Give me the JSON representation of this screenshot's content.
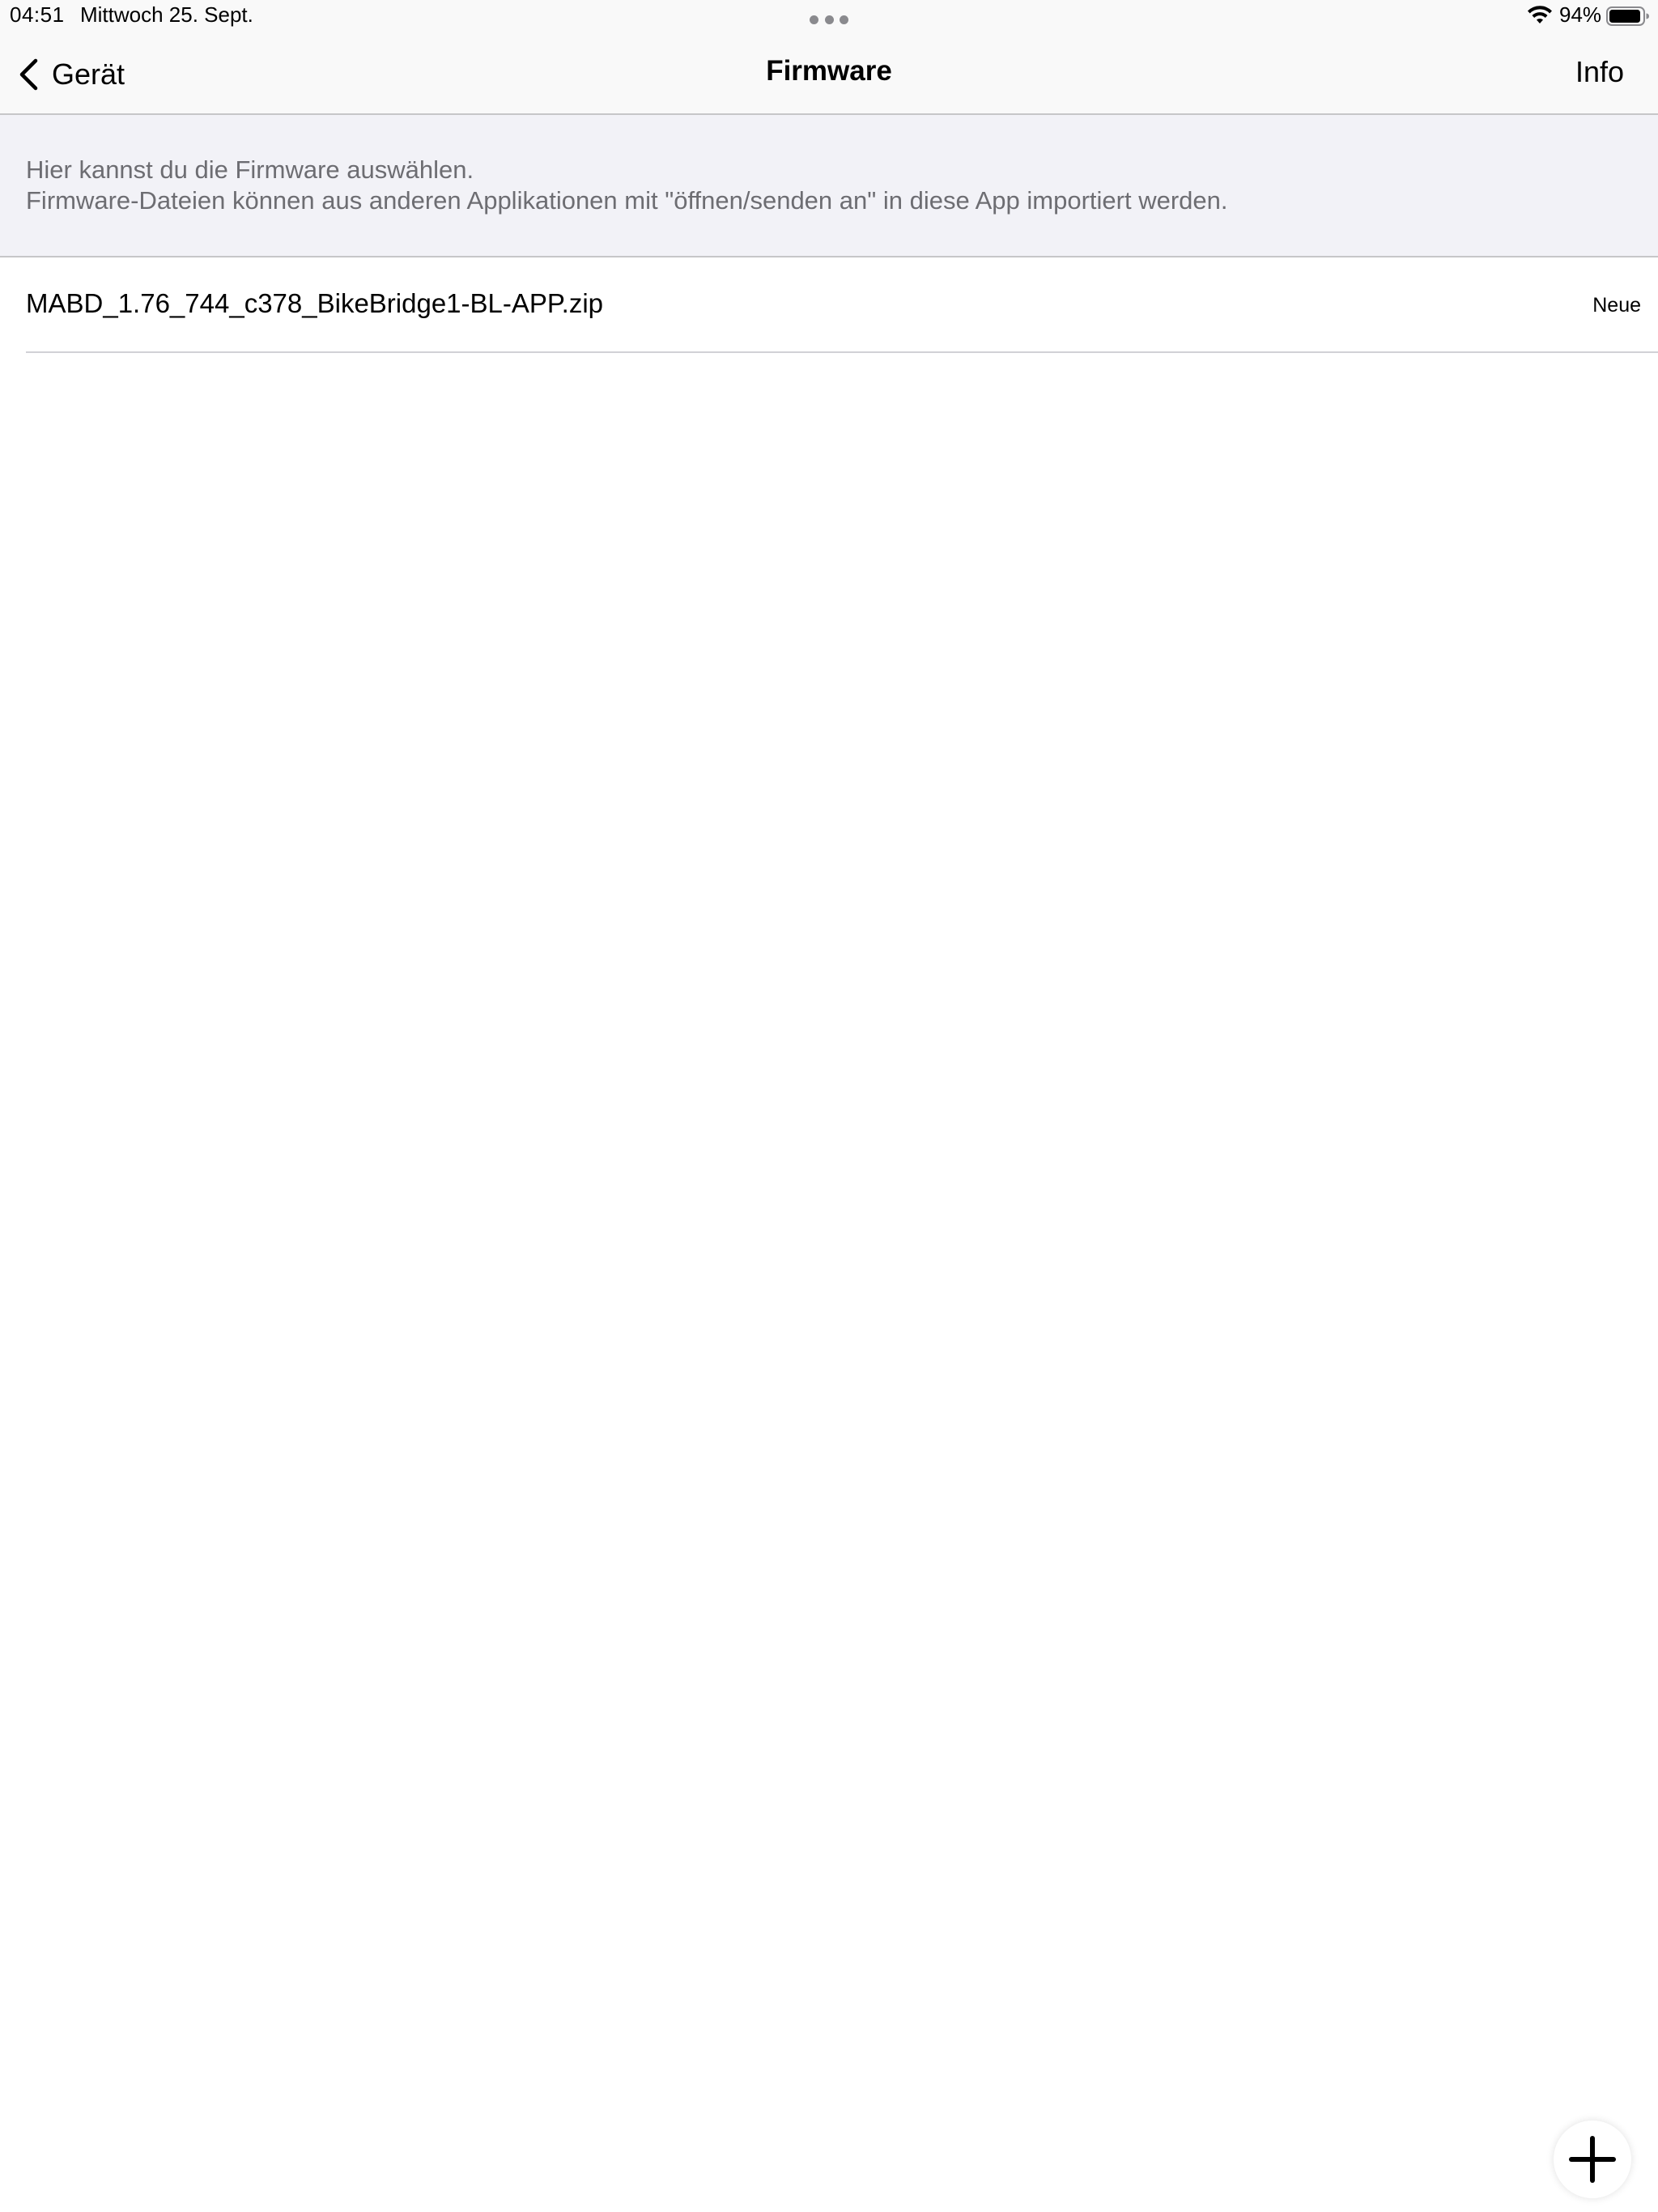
{
  "status_bar": {
    "time": "04:51",
    "date": "Mittwoch 25. Sept.",
    "battery": "94%",
    "icons": [
      "multitasking-dots-icon",
      "wifi-icon",
      "battery-icon"
    ]
  },
  "nav": {
    "back_label": "Gerät",
    "back_icon": "chevron-left-icon",
    "title": "Firmware",
    "info_label": "Info"
  },
  "section": {
    "line1": "Hier kannst du die Firmware auswählen.",
    "line2": "Firmware-Dateien können aus anderen Applikationen mit \"öffnen/senden an\" in diese App importiert werden."
  },
  "files": [
    {
      "name": "MABD_1.76_744_c378_BikeBridge1-BL-APP.zip",
      "status": "Neue"
    }
  ],
  "fab": {
    "icon": "plus-icon"
  },
  "colors": {
    "bar_background": "#f9f9f9",
    "header_background": "#f2f2f7",
    "secondary_text": "#6d6d72",
    "separator": "#c6c6c8"
  }
}
